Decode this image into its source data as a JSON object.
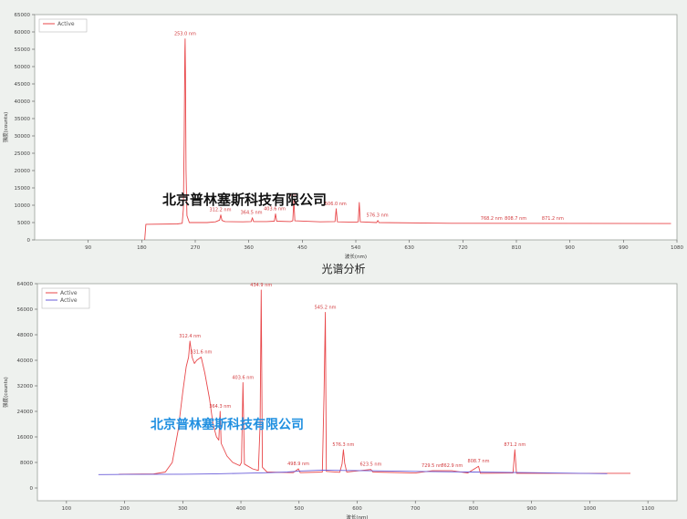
{
  "watermark": "北京普林塞斯科技有限公司",
  "chart_data": [
    {
      "type": "line",
      "title": "",
      "xlabel": "波长(nm)",
      "ylabel": "强度(counts)",
      "xlim": [
        0,
        1080
      ],
      "ylim": [
        0,
        65000
      ],
      "xticks": [
        90,
        180,
        270,
        360,
        450,
        540,
        630,
        720,
        810,
        900,
        990,
        1080
      ],
      "yticks": [
        0,
        5000,
        10000,
        15000,
        20000,
        25000,
        30000,
        35000,
        40000,
        45000,
        50000,
        55000,
        60000,
        65000
      ],
      "legend_position": "top-left",
      "series": [
        {
          "name": "Active",
          "color": "#e8474a",
          "points": [
            [
              185,
              0
            ],
            [
              187,
              4500
            ],
            [
              240,
              4600
            ],
            [
              248,
              4800
            ],
            [
              250,
              9000
            ],
            [
              251.5,
              30000
            ],
            [
              252.5,
              54000
            ],
            [
              253,
              58000
            ],
            [
              253.6,
              48000
            ],
            [
              254.5,
              20000
            ],
            [
              256,
              7000
            ],
            [
              260,
              5000
            ],
            [
              290,
              5000
            ],
            [
              304,
              5200
            ],
            [
              311,
              5700
            ],
            [
              313,
              7200
            ],
            [
              315,
              5600
            ],
            [
              320,
              5300
            ],
            [
              350,
              5200
            ],
            [
              364,
              5300
            ],
            [
              366,
              6400
            ],
            [
              368,
              5300
            ],
            [
              390,
              5300
            ],
            [
              403,
              5400
            ],
            [
              405,
              7500
            ],
            [
              407,
              5400
            ],
            [
              430,
              5300
            ],
            [
              434,
              5500
            ],
            [
              435.8,
              11500
            ],
            [
              437.5,
              5500
            ],
            [
              480,
              5200
            ],
            [
              505,
              5300
            ],
            [
              507,
              9000
            ],
            [
              509,
              5200
            ],
            [
              540,
              5100
            ],
            [
              544,
              5200
            ],
            [
              545.8,
              10800
            ],
            [
              547.5,
              5200
            ],
            [
              575,
              5000
            ],
            [
              577,
              5600
            ],
            [
              579,
              5000
            ],
            [
              700,
              4800
            ],
            [
              1070,
              4700
            ]
          ]
        }
      ],
      "peak_labels": [
        {
          "x": 253.0,
          "y": 58000,
          "text": "253.0 nm"
        },
        {
          "x": 312.2,
          "y": 7200,
          "text": "312.2 nm"
        },
        {
          "x": 364.5,
          "y": 6400,
          "text": "364.5 nm"
        },
        {
          "x": 403.6,
          "y": 7500,
          "text": "403.6 nm"
        },
        {
          "x": 435.8,
          "y": 11500,
          "text": "nm"
        },
        {
          "x": 506.0,
          "y": 9000,
          "text": "506.0 nm"
        },
        {
          "x": 576.3,
          "y": 5600,
          "text": "576.3 nm"
        },
        {
          "x": 768.2,
          "y": 4800,
          "text": "768.2 nm"
        },
        {
          "x": 808.7,
          "y": 4800,
          "text": "808.7 nm"
        },
        {
          "x": 871.2,
          "y": 4800,
          "text": "871.2 nm"
        }
      ]
    },
    {
      "type": "line",
      "title": "光谱分析",
      "xlabel": "波长(nm)",
      "ylabel": "强度(counts)",
      "xlim": [
        50,
        1150
      ],
      "ylim": [
        -4000,
        64000
      ],
      "xticks": [
        100,
        200,
        300,
        400,
        500,
        600,
        700,
        800,
        900,
        1000,
        1100
      ],
      "yticks": [
        0,
        8000,
        16000,
        24000,
        32000,
        40000,
        48000,
        56000,
        64000
      ],
      "legend_position": "top-left",
      "series": [
        {
          "name": "Active",
          "color": "#e8474a",
          "points": [
            [
              190,
              4300
            ],
            [
              250,
              4400
            ],
            [
              270,
              5000
            ],
            [
              282,
              8000
            ],
            [
              292,
              18000
            ],
            [
              300,
              30000
            ],
            [
              306,
              38000
            ],
            [
              310,
              41000
            ],
            [
              312.4,
              46000
            ],
            [
              316,
              41000
            ],
            [
              320,
              39000
            ],
            [
              324,
              40000
            ],
            [
              331.6,
              41000
            ],
            [
              338,
              36000
            ],
            [
              346,
              28000
            ],
            [
              352,
              20000
            ],
            [
              358,
              16000
            ],
            [
              362,
              15000
            ],
            [
              364.3,
              24000
            ],
            [
              366,
              14000
            ],
            [
              376,
              10000
            ],
            [
              386,
              8000
            ],
            [
              398,
              7000
            ],
            [
              401,
              8000
            ],
            [
              403.6,
              33000
            ],
            [
              406,
              7500
            ],
            [
              420,
              6000
            ],
            [
              430,
              5500
            ],
            [
              433,
              20000
            ],
            [
              434.9,
              62000
            ],
            [
              437,
              6500
            ],
            [
              445,
              5000
            ],
            [
              490,
              4800
            ],
            [
              498.9,
              6000
            ],
            [
              502,
              4800
            ],
            [
              540,
              5000
            ],
            [
              543,
              30000
            ],
            [
              545.2,
              55000
            ],
            [
              547,
              5200
            ],
            [
              570,
              4900
            ],
            [
              574,
              7500
            ],
            [
              576.3,
              12000
            ],
            [
              578.5,
              7800
            ],
            [
              582,
              5000
            ],
            [
              623.5,
              5800
            ],
            [
              627,
              5000
            ],
            [
              700,
              4700
            ],
            [
              729.5,
              5400
            ],
            [
              762.9,
              5400
            ],
            [
              790,
              4700
            ],
            [
              808.7,
              6800
            ],
            [
              812,
              4600
            ],
            [
              868,
              4700
            ],
            [
              871.2,
              12000
            ],
            [
              874,
              4600
            ],
            [
              1070,
              4600
            ]
          ]
        },
        {
          "name": "Active",
          "color": "#6a5cd8",
          "points": [
            [
              155,
              4200
            ],
            [
              200,
              4250
            ],
            [
              300,
              4300
            ],
            [
              350,
              4400
            ],
            [
              400,
              4600
            ],
            [
              450,
              4800
            ],
            [
              480,
              5000
            ],
            [
              500,
              5300
            ],
            [
              540,
              5600
            ],
            [
              580,
              5500
            ],
            [
              620,
              5400
            ],
            [
              700,
              5200
            ],
            [
              800,
              5000
            ],
            [
              900,
              4800
            ],
            [
              1030,
              4500
            ]
          ]
        }
      ],
      "peak_labels": [
        {
          "x": 312.4,
          "y": 46000,
          "text": "312.4 nm"
        },
        {
          "x": 331.6,
          "y": 41000,
          "text": "331.6 nm"
        },
        {
          "x": 364.3,
          "y": 24000,
          "text": "364.3 nm"
        },
        {
          "x": 403.6,
          "y": 33000,
          "text": "403.6 nm"
        },
        {
          "x": 434.9,
          "y": 62000,
          "text": "434.9 nm"
        },
        {
          "x": 498.9,
          "y": 6000,
          "text": "498.9 nm"
        },
        {
          "x": 545.2,
          "y": 55000,
          "text": "545.2 nm"
        },
        {
          "x": 576.3,
          "y": 12000,
          "text": "576.3 nm"
        },
        {
          "x": 623.5,
          "y": 5800,
          "text": "623.5 nm"
        },
        {
          "x": 729.5,
          "y": 5400,
          "text": "729.5 nm"
        },
        {
          "x": 762.9,
          "y": 5400,
          "text": "762.9 nm"
        },
        {
          "x": 808.7,
          "y": 6800,
          "text": "808.7 nm"
        },
        {
          "x": 871.2,
          "y": 12000,
          "text": "871.2 nm"
        }
      ]
    }
  ]
}
